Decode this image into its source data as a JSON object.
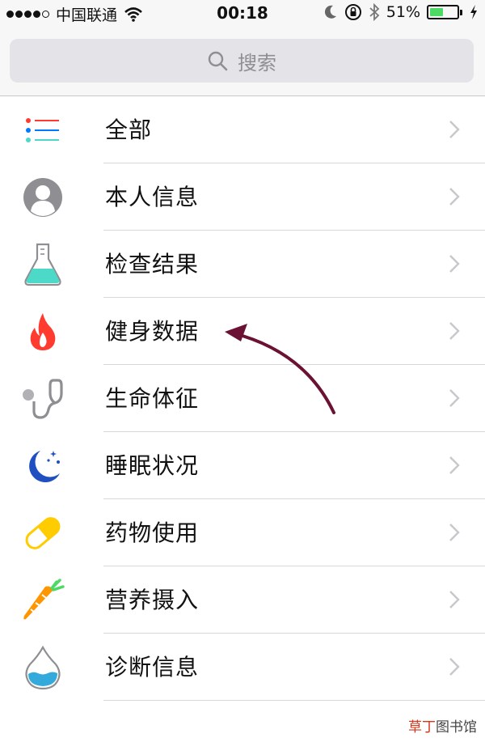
{
  "status_bar": {
    "carrier": "中国联通",
    "time": "00:18",
    "battery_percent": "51%",
    "battery_level": 0.51,
    "battery_color": "#4cd964",
    "icons": [
      "signal-dots",
      "wifi-icon",
      "moon-icon",
      "rotation-lock-icon",
      "bluetooth-icon",
      "battery-icon",
      "charging-icon"
    ]
  },
  "search": {
    "placeholder": "搜索"
  },
  "categories": [
    {
      "label": "全部",
      "icon": "list-icon"
    },
    {
      "label": "本人信息",
      "icon": "person-icon"
    },
    {
      "label": "检查结果",
      "icon": "flask-icon"
    },
    {
      "label": "健身数据",
      "icon": "flame-icon"
    },
    {
      "label": "生命体征",
      "icon": "stethoscope-icon"
    },
    {
      "label": "睡眠状况",
      "icon": "moon-stars-icon"
    },
    {
      "label": "药物使用",
      "icon": "pill-icon"
    },
    {
      "label": "营养摄入",
      "icon": "carrot-icon"
    },
    {
      "label": "诊断信息",
      "icon": "water-drop-icon"
    }
  ],
  "annotation_arrow_color": "#6b1133",
  "watermark": {
    "part1": "草丁",
    "part2": "图书馆"
  }
}
